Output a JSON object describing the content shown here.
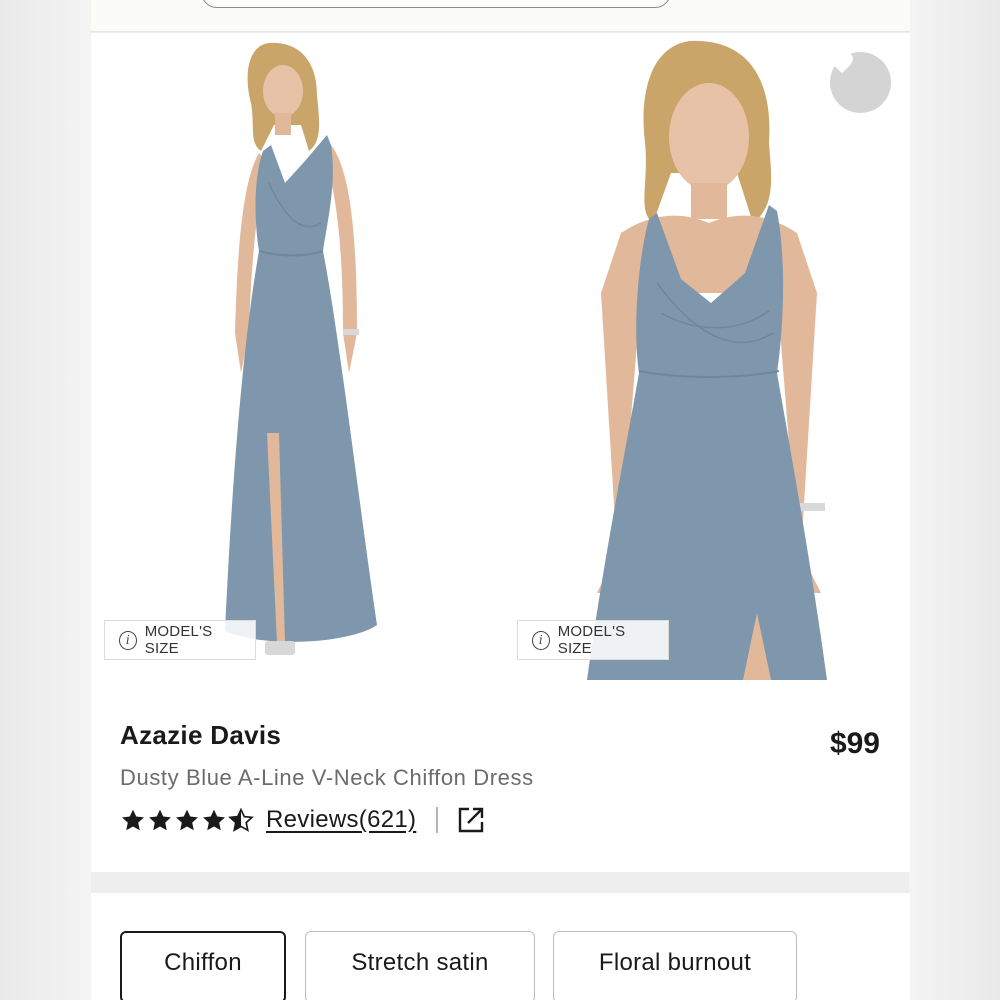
{
  "product": {
    "brand": "Azazie Davis",
    "price": "$99",
    "name": "Dusty Blue A-Line V-Neck Chiffon Dress",
    "rating": 4.5,
    "reviews_label": "Reviews(621)"
  },
  "gallery": {
    "model_size_label": "MODEL'S SIZE",
    "info_glyph": "i",
    "dress_color": "#7f97ad",
    "favorite_icon": "heart-icon"
  },
  "fabrics": {
    "options": [
      "Chiffon",
      "Stretch satin",
      "Floral burnout"
    ],
    "selected": "Chiffon"
  },
  "icons": {
    "share": "external-link-icon",
    "rating": "star-icon"
  }
}
